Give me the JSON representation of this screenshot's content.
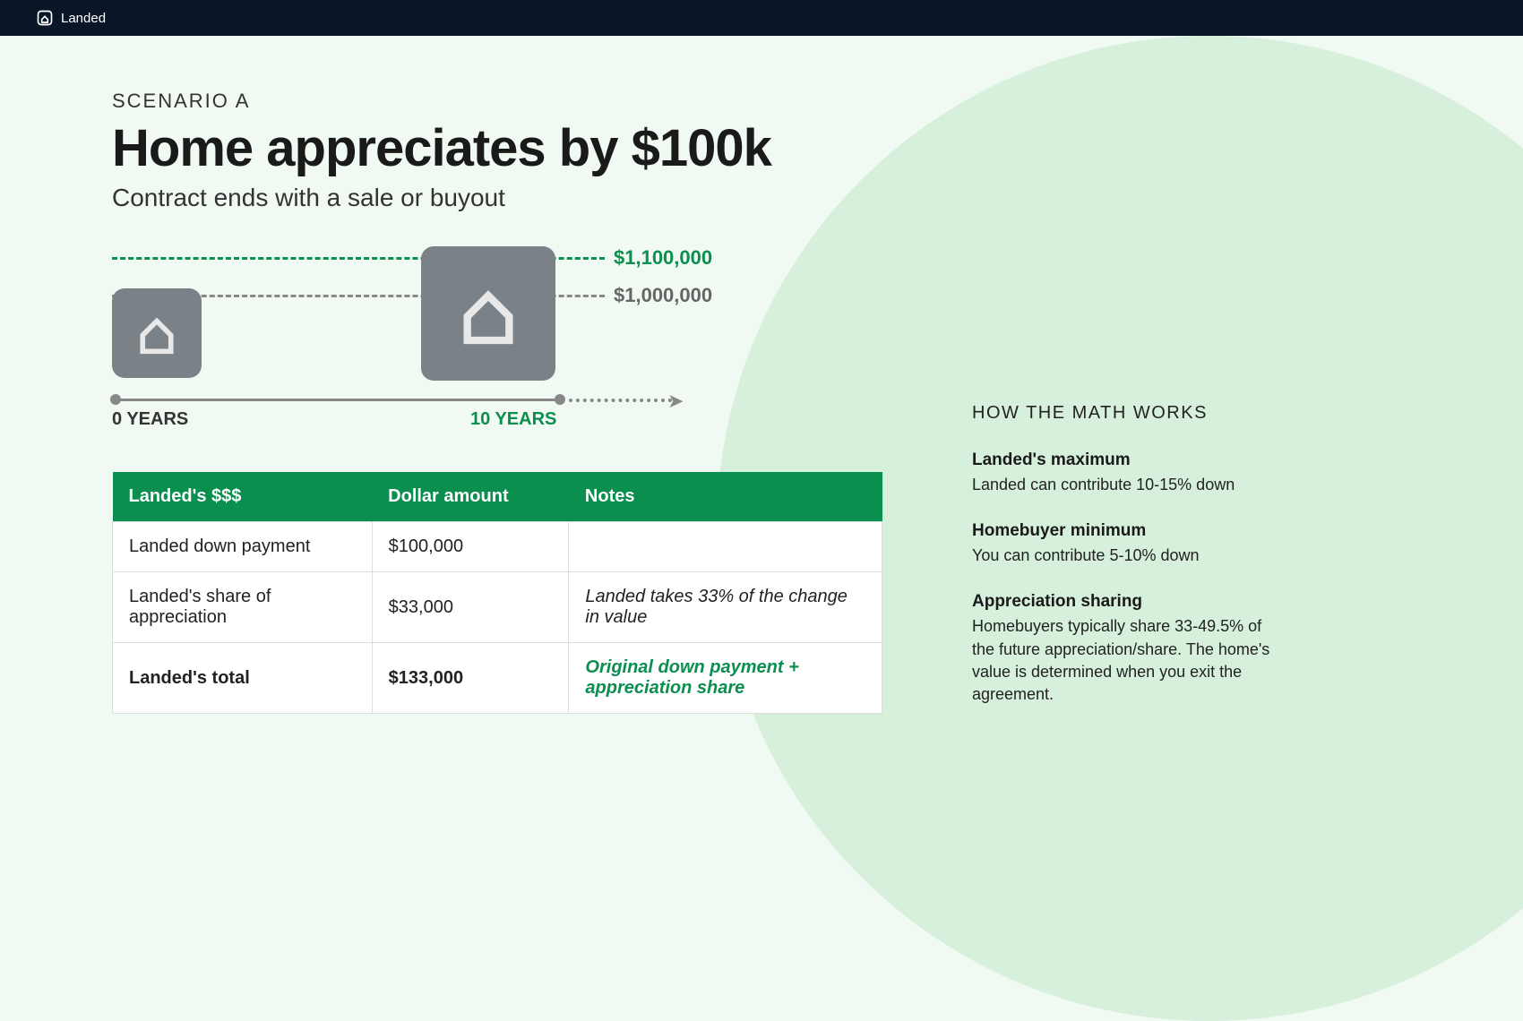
{
  "brand": "Landed",
  "header": {
    "eyebrow": "SCENARIO A",
    "title": "Home appreciates by $100k",
    "subtitle": "Contract ends with a sale or buyout"
  },
  "diagram": {
    "value_end": "$1,100,000",
    "value_start": "$1,000,000",
    "timeline_start": "0 YEARS",
    "timeline_end": "10 YEARS"
  },
  "table": {
    "headers": {
      "col1": "Landed's $$$",
      "col2": "Dollar amount",
      "col3": "Notes"
    },
    "rows": [
      {
        "label": "Landed down payment",
        "amount": "$100,000",
        "note": ""
      },
      {
        "label": "Landed's share of appreciation",
        "amount": "$33,000",
        "note": "Landed takes 33% of the change in value"
      }
    ],
    "total": {
      "label": "Landed's total",
      "amount": "$133,000",
      "note": "Original down payment + appreciation share"
    }
  },
  "sidebar": {
    "title": "HOW THE MATH WORKS",
    "blocks": [
      {
        "heading": "Landed's maximum",
        "body": "Landed can contribute 10-15% down"
      },
      {
        "heading": "Homebuyer minimum",
        "body": "You can contribute 5-10% down"
      },
      {
        "heading": "Appreciation sharing",
        "body": "Homebuyers typically share 33-49.5% of the future appreciation/share. The home's value is determined when you exit the agreement."
      }
    ]
  }
}
